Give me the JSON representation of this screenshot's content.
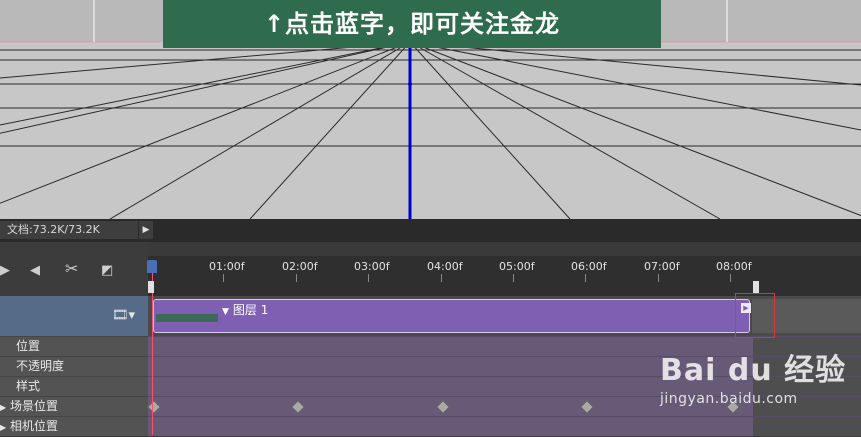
{
  "viewport": {
    "banner_text": "↑点击蓝字，即可关注金龙"
  },
  "status_bar": {
    "doc_info": "文档:73.2K/73.2K",
    "menu_arrow": "▶"
  },
  "timeline": {
    "tools": [
      {
        "name": "play-icon",
        "glyph": "▶"
      },
      {
        "name": "speaker-icon",
        "glyph": "◀"
      },
      {
        "name": "scissors-icon",
        "glyph": "✂"
      },
      {
        "name": "transition-icon",
        "glyph": "◩"
      }
    ],
    "ruler_labels": [
      "01:00f",
      "02:00f",
      "03:00f",
      "04:00f",
      "05:00f",
      "06:00f",
      "07:00f",
      "08:00f"
    ],
    "layer": {
      "name": "图层 1",
      "film_icon": "🎞▾",
      "clip_end_icon": "▶"
    },
    "properties": [
      {
        "label": "位置",
        "expandable": false
      },
      {
        "label": "不透明度",
        "expandable": false
      },
      {
        "label": "样式",
        "expandable": false
      },
      {
        "label": "场景位置",
        "expandable": true
      },
      {
        "label": "相机位置",
        "expandable": true
      }
    ]
  },
  "watermark": {
    "main": "Bai du 经验",
    "sub": "jingyan.baidu.com"
  },
  "colors": {
    "clip": "#7e5fb1",
    "playhead": "#ff4d6a",
    "banner": "#2f6b4d",
    "axis": "#0000cc"
  }
}
